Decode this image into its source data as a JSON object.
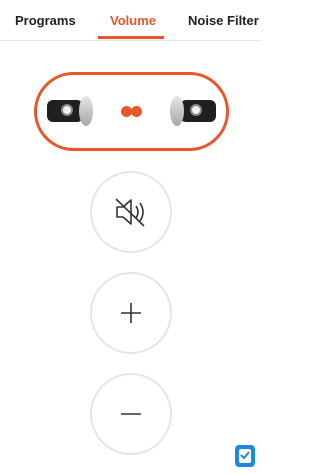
{
  "tabs": [
    {
      "label": "Programs",
      "active": false
    },
    {
      "label": "Volume",
      "active": true
    },
    {
      "label": "Noise Filter",
      "active": false
    }
  ],
  "colors": {
    "accent": "#e8562a",
    "text": "#222222",
    "border": "#e6e6e6",
    "badge": "#1e88e5"
  },
  "device_panel": {
    "left_aid_icon": "hearing-aid-left-icon",
    "right_aid_icon": "hearing-aid-right-icon",
    "sync_icon": "link-dots-icon"
  },
  "controls": {
    "mute_icon": "speaker-muted-icon",
    "increase_icon": "plus-icon",
    "decrease_icon": "minus-icon"
  },
  "badge_icon": "checklist-icon"
}
